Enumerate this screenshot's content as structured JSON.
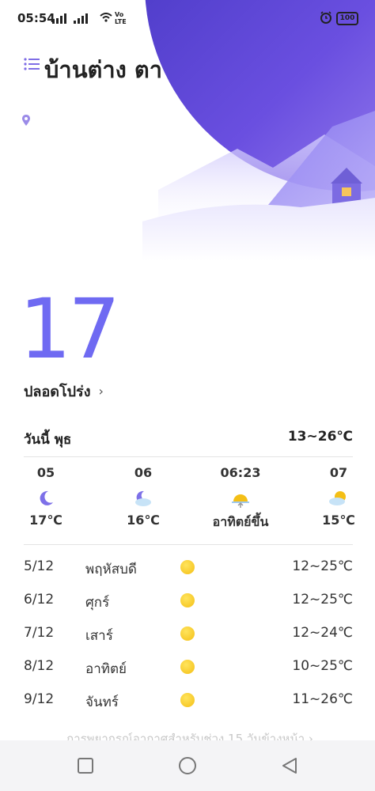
{
  "status_bar": {
    "time": "05:54",
    "network": "Vo LTE",
    "battery": "100"
  },
  "header": {
    "city": "บ้านต่าง ตา",
    "menu_icon": "menu-icon",
    "location_icon": "location-pin-icon"
  },
  "current": {
    "temperature": "17",
    "condition": "ปลอดโปร่ง",
    "chevron": "›"
  },
  "today": {
    "label": "วันนี้  พุธ",
    "range": "13~26℃"
  },
  "hourly": [
    {
      "time": "05",
      "icon": "moon-icon",
      "temp": "17℃"
    },
    {
      "time": "06",
      "icon": "moon-cloud-icon",
      "temp": "16℃"
    },
    {
      "time": "06:23",
      "icon": "sunrise-icon",
      "temp": "อาทิตย์ขึ้น"
    },
    {
      "time": "07",
      "icon": "sun-cloud-icon",
      "temp": "15℃"
    }
  ],
  "daily": [
    {
      "date": "5/12",
      "day": "พฤหัสบดี",
      "icon": "sun-icon",
      "range": "12~25℃"
    },
    {
      "date": "6/12",
      "day": "ศุกร์",
      "icon": "sun-icon",
      "range": "12~25℃"
    },
    {
      "date": "7/12",
      "day": "เสาร์",
      "icon": "sun-icon",
      "range": "12~24℃"
    },
    {
      "date": "8/12",
      "day": "อาทิตย์",
      "icon": "sun-icon",
      "range": "10~25℃"
    },
    {
      "date": "9/12",
      "day": "จันทร์",
      "icon": "sun-icon",
      "range": "11~26℃"
    }
  ],
  "forecast_link": "การพยากรณ์อากาศสำหรับช่วง 15 วันข้างหน้า ›",
  "nav": {
    "recent": "square-icon",
    "home": "circle-icon",
    "back": "triangle-back-icon"
  },
  "colors": {
    "accent": "#6f6af2",
    "sky_dark": "#3a2fb8",
    "sky_light": "#8a7cf0",
    "sun": "#f4bf16"
  }
}
